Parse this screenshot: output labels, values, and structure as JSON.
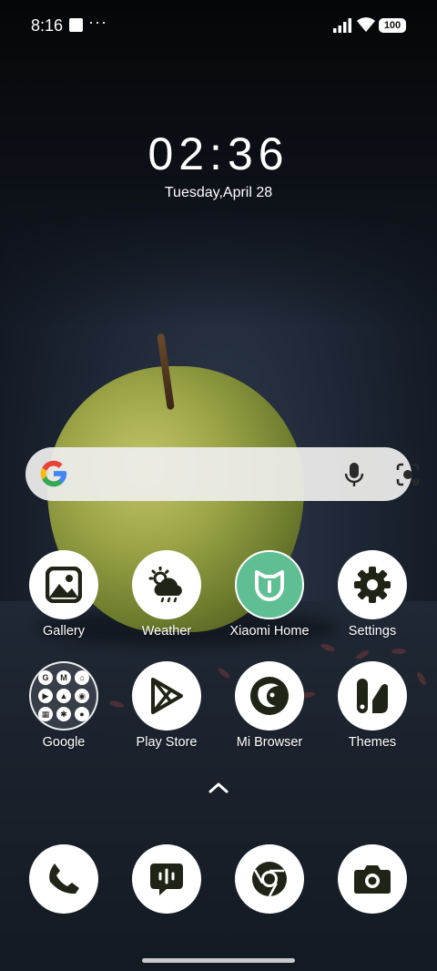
{
  "status_bar": {
    "time": "8:16",
    "dots": "···",
    "battery": "100"
  },
  "lock": {
    "clock": "02:36",
    "date": "Tuesday,April 28"
  },
  "search": {
    "icon": "google-g-icon",
    "mic_icon": "microphone-icon",
    "lens_icon": "camera-lens-icon"
  },
  "apps": [
    {
      "label": "Gallery",
      "icon": "gallery-icon"
    },
    {
      "label": "Weather",
      "icon": "weather-icon"
    },
    {
      "label": "Xiaomi Home",
      "icon": "xiaomi-home-icon"
    },
    {
      "label": "Settings",
      "icon": "gear-icon"
    },
    {
      "label": "Google",
      "icon": "google-folder-icon"
    },
    {
      "label": "Play Store",
      "icon": "play-store-icon"
    },
    {
      "label": "Mi Browser",
      "icon": "mi-browser-icon"
    },
    {
      "label": "Themes",
      "icon": "themes-icon"
    }
  ],
  "folder_glyphs": [
    "G",
    "M",
    "⌂",
    "▶",
    "▲",
    "◉",
    "▦",
    "✱",
    "●"
  ],
  "dock": [
    {
      "icon": "phone-icon"
    },
    {
      "icon": "messages-icon"
    },
    {
      "icon": "chrome-icon"
    },
    {
      "icon": "camera-icon"
    }
  ],
  "colors": {
    "icon_dark": "#1f2416",
    "xiaomi_green": "#5fbf92"
  }
}
